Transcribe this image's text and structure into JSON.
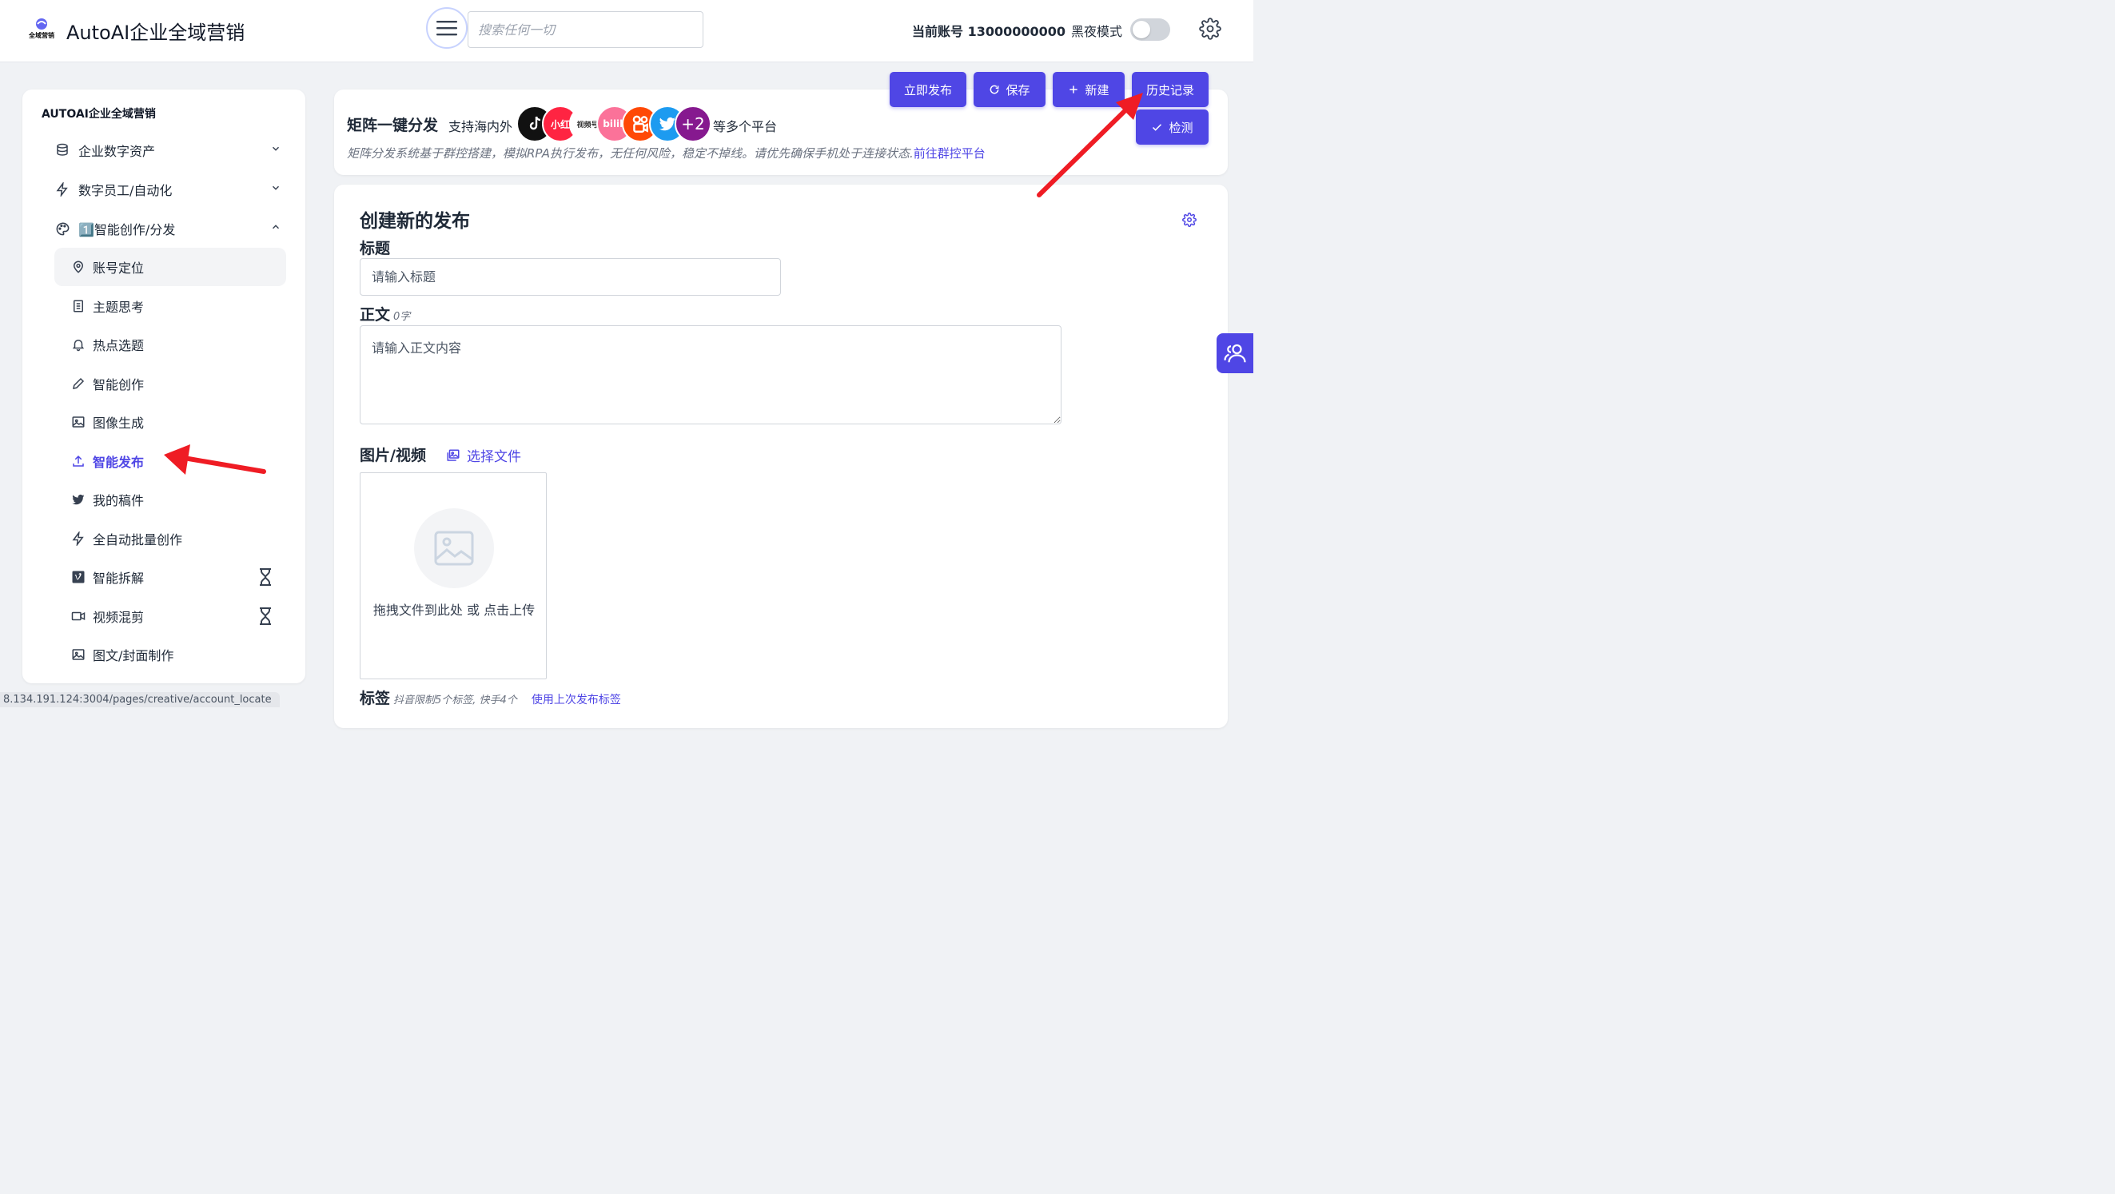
{
  "header": {
    "app_title": "AutoAI企业全域营销",
    "logo_text": "全域营销",
    "search_placeholder": "搜索任何一切",
    "account_label": "当前账号 13000000000",
    "dark_mode_label": "黑夜模式",
    "dark_mode_on": false
  },
  "sidebar": {
    "brand": "AUTOAI企业全域营销",
    "groups": [
      {
        "label": "企业数字资产",
        "icon": "database-icon",
        "expanded": false
      },
      {
        "label": "数字员工/自动化",
        "icon": "lightning-icon",
        "expanded": false
      },
      {
        "label": "1️⃣智能创作/分发",
        "icon": "palette-icon",
        "expanded": true
      }
    ],
    "sub_items": [
      {
        "label": "账号定位",
        "icon": "location-pin-icon"
      },
      {
        "label": "主题思考",
        "icon": "document-list-icon"
      },
      {
        "label": "热点选题",
        "icon": "bell-icon"
      },
      {
        "label": "智能创作",
        "icon": "pencil-icon"
      },
      {
        "label": "图像生成",
        "icon": "image-icon"
      },
      {
        "label": "智能发布",
        "icon": "upload-icon"
      },
      {
        "label": "我的稿件",
        "icon": "twitter-bird-icon"
      },
      {
        "label": "全自动批量创作",
        "icon": "lightning-icon"
      },
      {
        "label": "智能拆解",
        "icon": "vimeo-icon"
      },
      {
        "label": "视频混剪",
        "icon": "video-camera-icon"
      },
      {
        "label": "图文/封面制作",
        "icon": "image-icon"
      }
    ],
    "selected_item": "账号定位",
    "active_item": "智能发布"
  },
  "status_url": "8.134.191.124:3004/pages/creative/account_locate",
  "intro": {
    "title": "矩阵一键分发",
    "support_text": "支持海内外",
    "platforms": [
      "TikTok",
      "小红书",
      "视频号",
      "bilibili",
      "快手",
      "Twitter"
    ],
    "platform_labels": {
      "xhs": "小红",
      "shipin": "视频号",
      "bili": "bilib",
      "more": "+2"
    },
    "more_text": "等多个平台",
    "description": "矩阵分发系统基于群控搭建，模拟RPA执行发布，无任何风险，稳定不掉线。请优先确保手机处于连接状态.",
    "link_text": "前往群控平台"
  },
  "actions": {
    "publish": "立即发布",
    "save": "保存",
    "new": "新建",
    "history": "历史记录",
    "check": "检测"
  },
  "form": {
    "title": "创建新的发布",
    "title_label": "标题",
    "title_placeholder": "请输入标题",
    "body_label": "正文",
    "body_count": "0字",
    "body_placeholder": "请输入正文内容",
    "media_label": "图片/视频",
    "choose_file": "选择文件",
    "upload_text": "拖拽文件到此处 或 点击上传",
    "tags_label": "标签",
    "tags_hint": "抖音限制5个标签, 快手4个",
    "tags_link": "使用上次发布标签"
  },
  "colors": {
    "accent": "#4f46e5",
    "annotation_arrow": "#ef1c24"
  }
}
